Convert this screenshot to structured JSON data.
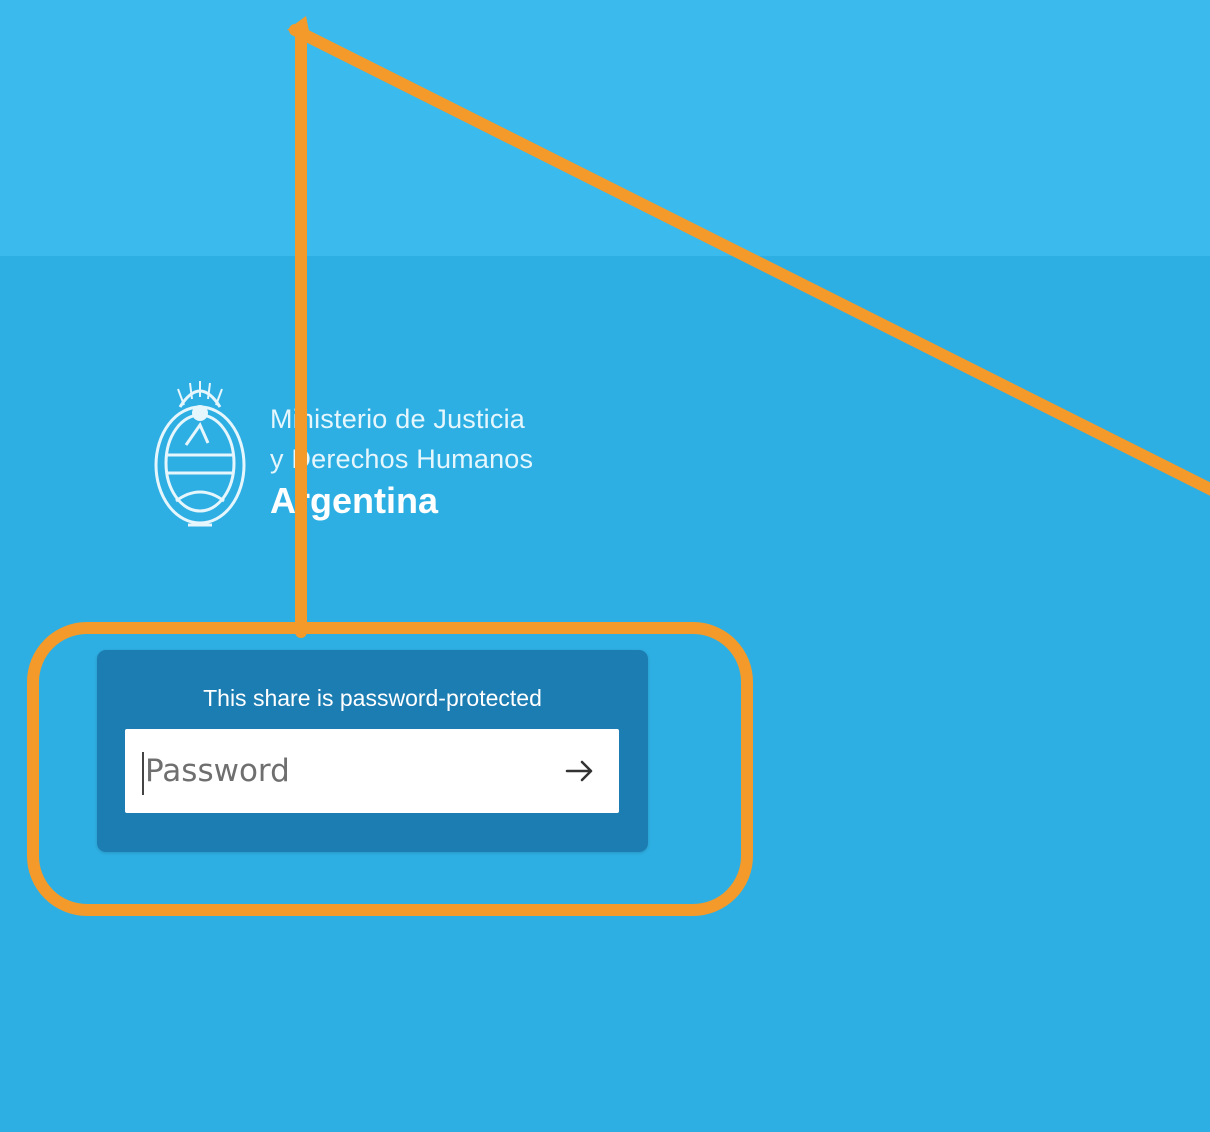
{
  "logo": {
    "line1": "Ministerio de Justicia",
    "line2": "y Derechos Humanos",
    "line3": "Argentina",
    "emblem_icon": "argentina-coat-of-arms-icon"
  },
  "share_form": {
    "title": "This share is password-protected",
    "password_placeholder": "Password",
    "password_value": "",
    "submit_icon": "arrow-right-icon"
  },
  "colors": {
    "background": "#2eafe3",
    "header_band": "#3abaed",
    "card": "#1c7db2",
    "annotation": "#f39a2a"
  }
}
